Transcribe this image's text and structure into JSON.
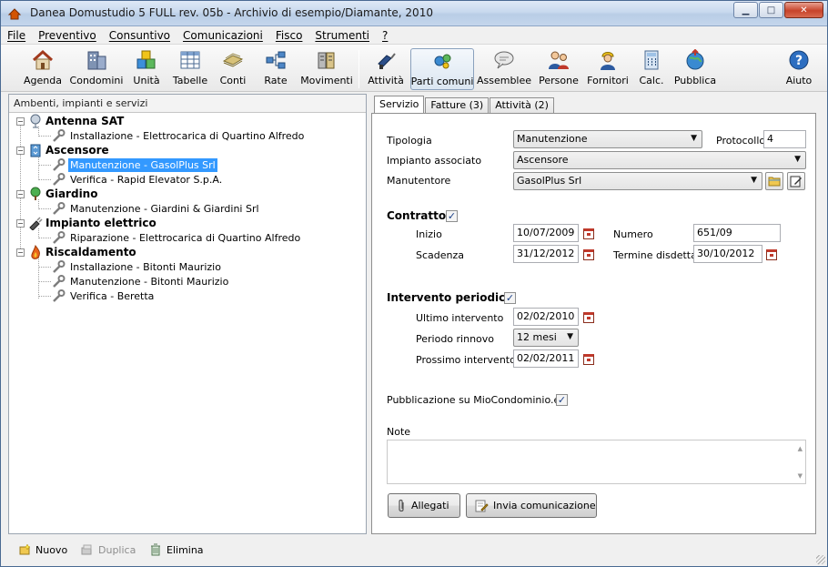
{
  "window": {
    "title": "Danea Domustudio 5 FULL rev. 05b - Archivio di esempio/Diamante, 2010"
  },
  "menu": [
    "File",
    "Preventivo",
    "Consuntivo",
    "Comunicazioni",
    "Fisco",
    "Strumenti",
    "?"
  ],
  "toolbar": [
    {
      "label": "Agenda",
      "icon": "house-icon"
    },
    {
      "label": "Condomini",
      "icon": "building-icon"
    },
    {
      "label": "Unità",
      "icon": "blocks-icon"
    },
    {
      "label": "Tabelle",
      "icon": "table-icon"
    },
    {
      "label": "Conti",
      "icon": "cash-icon"
    },
    {
      "label": "Rate",
      "icon": "rate-icon"
    },
    {
      "label": "Movimenti",
      "icon": "movements-icon"
    },
    {
      "label": "Attività",
      "icon": "drill-icon"
    },
    {
      "label": "Parti comuni",
      "icon": "parts-icon"
    },
    {
      "label": "Assemblee",
      "icon": "speech-icon"
    },
    {
      "label": "Persone",
      "icon": "people-icon"
    },
    {
      "label": "Fornitori",
      "icon": "worker-icon"
    },
    {
      "label": "Calc.",
      "icon": "calculator-icon"
    },
    {
      "label": "Pubblica",
      "icon": "globe-icon"
    },
    {
      "label": "Aiuto",
      "icon": "help-icon"
    }
  ],
  "left_panel": {
    "header": "Ambenti, impianti e servizi",
    "tree": [
      {
        "label": "Antenna SAT",
        "icon": "antenna-icon",
        "children": [
          "Installazione - Elettrocarica di Quartino Alfredo"
        ]
      },
      {
        "label": "Ascensore",
        "icon": "elevator-icon",
        "children": [
          "Manutenzione - GasolPlus Srl",
          "Verifica - Rapid Elevator S.p.A."
        ]
      },
      {
        "label": "Giardino",
        "icon": "tree-icon",
        "children": [
          "Manutenzione - Giardini & Giardini Srl"
        ]
      },
      {
        "label": "Impianto elettrico",
        "icon": "plug-icon",
        "children": [
          "Riparazione - Elettrocarica di Quartino Alfredo"
        ]
      },
      {
        "label": "Riscaldamento",
        "icon": "flame-icon",
        "children": [
          "Installazione - Bitonti Maurizio",
          "Manutenzione - Bitonti Maurizio",
          "Verifica - Beretta"
        ]
      }
    ]
  },
  "tabs": [
    "Servizio",
    "Fatture (3)",
    "Attività (2)"
  ],
  "form": {
    "tipologia_label": "Tipologia",
    "tipologia_value": "Manutenzione",
    "protocollo_label": "Protocollo",
    "protocollo_value": "4",
    "impianto_label": "Impianto associato",
    "impianto_value": "Ascensore",
    "manutentore_label": "Manutentore",
    "manutentore_value": "GasolPlus Srl",
    "contratto_label": "Contratto",
    "contratto_checked": true,
    "inizio_label": "Inizio",
    "inizio_value": "10/07/2009",
    "numero_label": "Numero",
    "numero_value": "651/09",
    "scadenza_label": "Scadenza",
    "scadenza_value": "31/12/2012",
    "termine_label": "Termine disdetta",
    "termine_value": "30/10/2012",
    "periodico_label": "Intervento periodico",
    "periodico_checked": true,
    "ultimo_label": "Ultimo intervento",
    "ultimo_value": "02/02/2010",
    "periodo_label": "Periodo rinnovo",
    "periodo_value": "12 mesi",
    "prossimo_label": "Prossimo intervento",
    "prossimo_value": "02/02/2011",
    "pubblicazione_label": "Pubblicazione su MioCondominio.eu",
    "pubblicazione_checked": true,
    "note_label": "Note",
    "note_value": "",
    "allegati_label": "Allegati",
    "invia_label": "Invia comunicazione"
  },
  "bottom": {
    "nuovo": "Nuovo",
    "duplica": "Duplica",
    "elimina": "Elimina"
  }
}
